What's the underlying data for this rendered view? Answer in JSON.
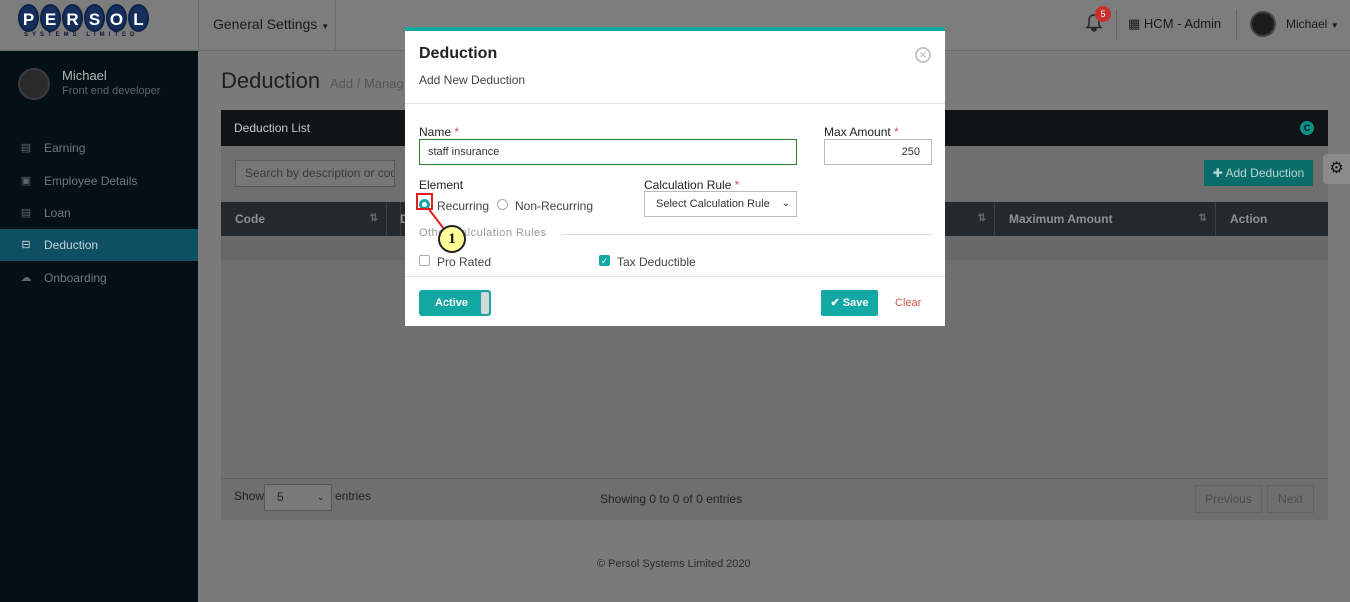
{
  "topbar": {
    "logo_text": "PERSOL",
    "logo_letters": [
      "P",
      "E",
      "R",
      "S",
      "O",
      "L"
    ],
    "logo_subtitle": "SYSTEMS LIMITED",
    "general_settings": "General Settings",
    "notification_count": "5",
    "app_switch": "HCM - Admin",
    "username": "Michael"
  },
  "sidebar": {
    "profile_name": "Michael",
    "profile_role": "Front end developer",
    "items": [
      {
        "label": "Earning",
        "icon": "money-icon"
      },
      {
        "label": "Employee Details",
        "icon": "id-card-icon"
      },
      {
        "label": "Loan",
        "icon": "money-icon"
      },
      {
        "label": "Deduction",
        "icon": "minus-square-icon",
        "active": true
      },
      {
        "label": "Onboarding",
        "icon": "cloud-upload-icon"
      }
    ]
  },
  "main": {
    "title": "Deduction",
    "subtitle": "Add / Manag",
    "card_title": "Deduction List",
    "search_placeholder": "Search by description or code o",
    "add_button": "Add Deduction",
    "columns": [
      "Code",
      "D",
      "Maximum Amount",
      "Action"
    ],
    "show_label": "Show",
    "page_size": "5",
    "entries_label": "entries",
    "showing_text": "Showing 0 to 0 of 0 entries",
    "previous": "Previous",
    "next": "Next",
    "copyright": "© Persol Systems Limited 2020"
  },
  "modal": {
    "title": "Deduction",
    "subtitle": "Add New Deduction",
    "name_label": "Name",
    "name_value": "staff insurance",
    "max_amount_label": "Max Amount",
    "max_amount_value": "250",
    "required_mark": "*",
    "element_label": "Element",
    "element_options": [
      "Recurring",
      "Non-Recurring"
    ],
    "element_selected": "Recurring",
    "calc_rule_label": "Calculation Rule",
    "calc_rule_value": "Select Calculation Rule",
    "other_rules_label": "Other Calculation Rules",
    "pro_rated_label": "Pro Rated",
    "pro_rated_checked": false,
    "tax_deductible_label": "Tax Deductible",
    "tax_deductible_checked": true,
    "active_label": "Active",
    "save_label": "Save",
    "clear_label": "Clear"
  },
  "annotation": {
    "step": "1"
  },
  "colors": {
    "accent": "#14a8a5",
    "sidebar_bg": "#031015",
    "active_item": "#0f4f63",
    "danger": "#d9534f"
  }
}
